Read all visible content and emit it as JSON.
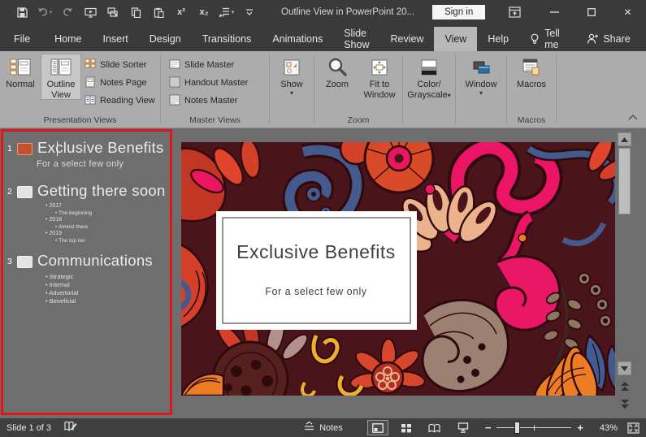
{
  "titlebar": {
    "title": "Outline View in PowerPoint 20...",
    "sign_in": "Sign in"
  },
  "glyphs": {
    "dropdown": "▾",
    "close": "✕",
    "superscript": "x²",
    "subscript": "x₂",
    "zoom_out": "−",
    "zoom_in": "+"
  },
  "qat_icons": [
    "save-icon",
    "undo-icon",
    "redo-icon",
    "start-from-beginning-icon",
    "slide-show-cursor-icon",
    "copy-icon",
    "paste-icon",
    "superscript-icon",
    "subscript-icon",
    "indent-list-icon",
    "more-commands-icon"
  ],
  "tabs": {
    "items": [
      "File",
      "Home",
      "Insert",
      "Design",
      "Transitions",
      "Animations",
      "Slide Show",
      "Review",
      "View",
      "Help"
    ],
    "active": "View",
    "tell_me": "Tell me",
    "share": "Share"
  },
  "ribbon": {
    "presentation_views": {
      "label": "Presentation Views",
      "normal": "Normal",
      "outline_view": "Outline View",
      "slide_sorter": "Slide Sorter",
      "notes_page": "Notes Page",
      "reading_view": "Reading View",
      "selected": "Outline View"
    },
    "master_views": {
      "label": "Master Views",
      "slide_master": "Slide Master",
      "handout_master": "Handout Master",
      "notes_master": "Notes Master"
    },
    "show": {
      "label": "Show"
    },
    "zoom_group": {
      "label": "Zoom",
      "zoom": "Zoom",
      "fit_to_window": "Fit to Window"
    },
    "color_grayscale": {
      "line1": "Color/",
      "line2": "Grayscale"
    },
    "window_menu": {
      "label": "Window"
    },
    "macros": {
      "label": "Macros",
      "group_label": "Macros"
    }
  },
  "outline": {
    "slides": [
      {
        "number": "1",
        "title": "Exclusive Benefits",
        "subtitle": "For a select few only"
      },
      {
        "number": "2",
        "title": "Getting there soon",
        "bullets": [
          {
            "level": 1,
            "text": "2017"
          },
          {
            "level": 2,
            "text": "The beginning"
          },
          {
            "level": 1,
            "text": "2018"
          },
          {
            "level": 2,
            "text": "Almost there"
          },
          {
            "level": 1,
            "text": "2019"
          },
          {
            "level": 2,
            "text": "The top tier"
          }
        ]
      },
      {
        "number": "3",
        "title": "Communications",
        "bullets": [
          {
            "level": 1,
            "text": "Strategic"
          },
          {
            "level": 1,
            "text": "Internal"
          },
          {
            "level": 1,
            "text": "Advertorial"
          },
          {
            "level": 1,
            "text": "Beneficial"
          }
        ]
      }
    ]
  },
  "slide": {
    "title": "Exclusive Benefits",
    "subtitle": "For a select few only"
  },
  "statusbar": {
    "slide_indicator": "Slide 1 of 3",
    "notes": "Notes",
    "zoom_level": "43%"
  },
  "colors": {
    "annotation_red": "#e01616",
    "titlebar": "#3a3a3a",
    "ribbon": "#acacac",
    "workspace": "#6e6e6e",
    "statusbar": "#3f3f3f",
    "active_tab": "#b8b8b8",
    "selected_button": "#c7c7c7",
    "slide_maroon": "#4a141b",
    "art_red": "#d5402a",
    "art_pink": "#e8175f",
    "art_blue": "#44598c",
    "art_tan": "#ecb28c",
    "art_orange": "#ec7d25",
    "art_yellow": "#eeb02c",
    "art_brown": "#8d7560",
    "art_taupe": "#9c8173"
  }
}
